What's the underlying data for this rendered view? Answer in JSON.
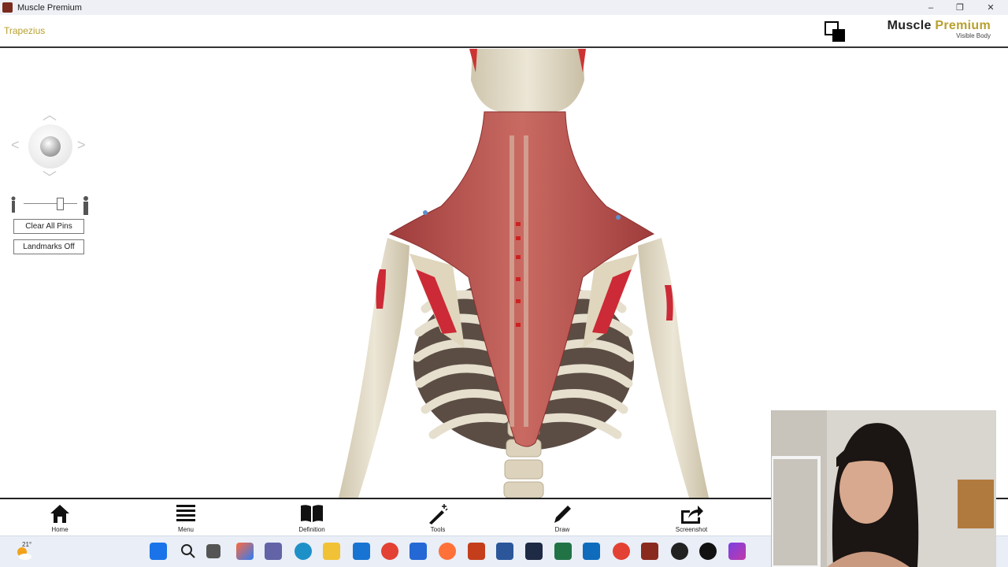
{
  "window": {
    "title": "Muscle Premium",
    "minimize_icon": "minimize-icon",
    "restore_icon": "restore-icon",
    "close_icon": "close-icon",
    "close_label": "✕",
    "restore_label": "❐",
    "minimize_label": "–"
  },
  "header": {
    "selected_structure": "Trapezius",
    "brand_first": "Muscle",
    "brand_second": "Premium",
    "brand_sub": "Visible Body"
  },
  "controls": {
    "clear_pins": "Clear All Pins",
    "landmarks": "Landmarks Off"
  },
  "toolbar": [
    {
      "label": "Home",
      "icon": "home-icon"
    },
    {
      "label": "Menu",
      "icon": "menu-icon"
    },
    {
      "label": "Definition",
      "icon": "book-icon"
    },
    {
      "label": "Tools",
      "icon": "magic-wand-icon"
    },
    {
      "label": "Draw",
      "icon": "pencil-icon"
    },
    {
      "label": "Screenshot",
      "icon": "share-icon"
    }
  ],
  "taskbar": {
    "temperature": "21°"
  },
  "colors": {
    "muscle": "#b54a4a",
    "bone": "#e3dcc8",
    "accent": "#b8a02e",
    "marker": "#cc1f2f"
  }
}
